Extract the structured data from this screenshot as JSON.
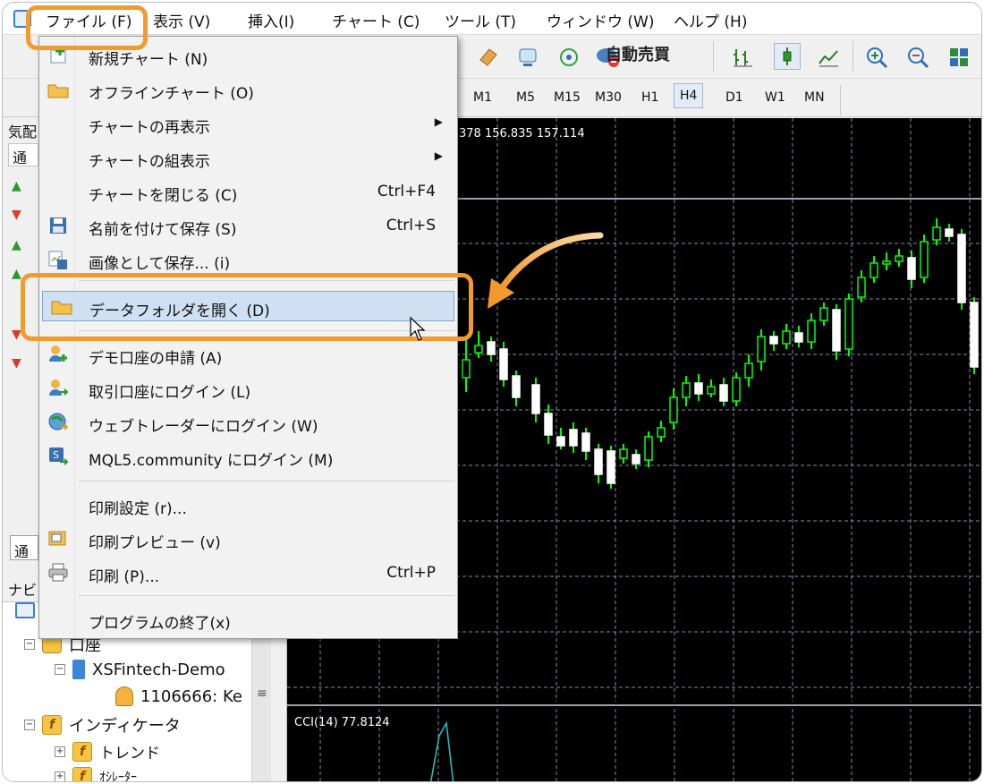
{
  "menubar": {
    "items": [
      "ファイル (F)",
      "表示 (V)",
      "挿入(I)",
      "チャート (C)",
      "ツール (T)",
      "ウィンドウ (W)",
      "ヘルプ (H)"
    ]
  },
  "toolbar": {
    "auto_trade_label": "自動売買",
    "timeframes": [
      "M1",
      "M5",
      "M15",
      "M30",
      "H1",
      "H4",
      "D1",
      "W1",
      "MN"
    ],
    "active_timeframe": "H4"
  },
  "chart": {
    "price_text": "378 156.835 157.114",
    "cci_text": "CCI(14) 77.8124",
    "background": "#000000",
    "bull_color": "#ffffff",
    "wick_color": "#00ff00"
  },
  "left_panel": {
    "market_header": "気配",
    "tab_label": "通",
    "bottom_tab": "通",
    "navigator_header": "ナビ",
    "tree": {
      "accounts_label": "口座",
      "server_label": "XSFintech-Demo",
      "account_label": "1106666: Ke",
      "indicators_label": "インディケータ",
      "trend_label": "トレンド",
      "oscillator_label": "ｵｼﾚｰﾀｰ"
    }
  },
  "file_menu": {
    "items": [
      {
        "label": "新規チャート (N)",
        "icon": "new-chart-icon"
      },
      {
        "label": "オフラインチャート (O)",
        "icon": "open-folder-icon"
      },
      {
        "label": "チャートの再表示",
        "submenu": true
      },
      {
        "label": "チャートの組表示",
        "submenu": true
      },
      {
        "label": "チャートを閉じる (C)",
        "shortcut": "Ctrl+F4"
      },
      {
        "label": "名前を付けて保存 (S)",
        "shortcut": "Ctrl+S",
        "icon": "save-icon"
      },
      {
        "label": "画像として保存... (i)",
        "icon": "save-image-icon"
      },
      {
        "label": "データフォルダを開く (D)",
        "icon": "folder-icon",
        "highlighted": true
      },
      {
        "label": "デモ口座の申請 (A)",
        "icon": "add-user-icon"
      },
      {
        "label": "取引口座にログイン (L)",
        "icon": "login-user-icon"
      },
      {
        "label": "ウェブトレーダーにログイン (W)",
        "icon": "globe-icon"
      },
      {
        "label": "MQL5.community にログイン (M)",
        "icon": "mql5-icon"
      },
      {
        "label": "印刷設定 (r)...",
        "icon": ""
      },
      {
        "label": "印刷プレビュー (v)",
        "icon": "print-preview-icon"
      },
      {
        "label": "印刷 (P)...",
        "shortcut": "Ctrl+P",
        "icon": "printer-icon"
      },
      {
        "label": "プログラムの終了(x)"
      }
    ]
  },
  "accent_color": "#f39a2c",
  "highlight_color": "#cfe0f3"
}
